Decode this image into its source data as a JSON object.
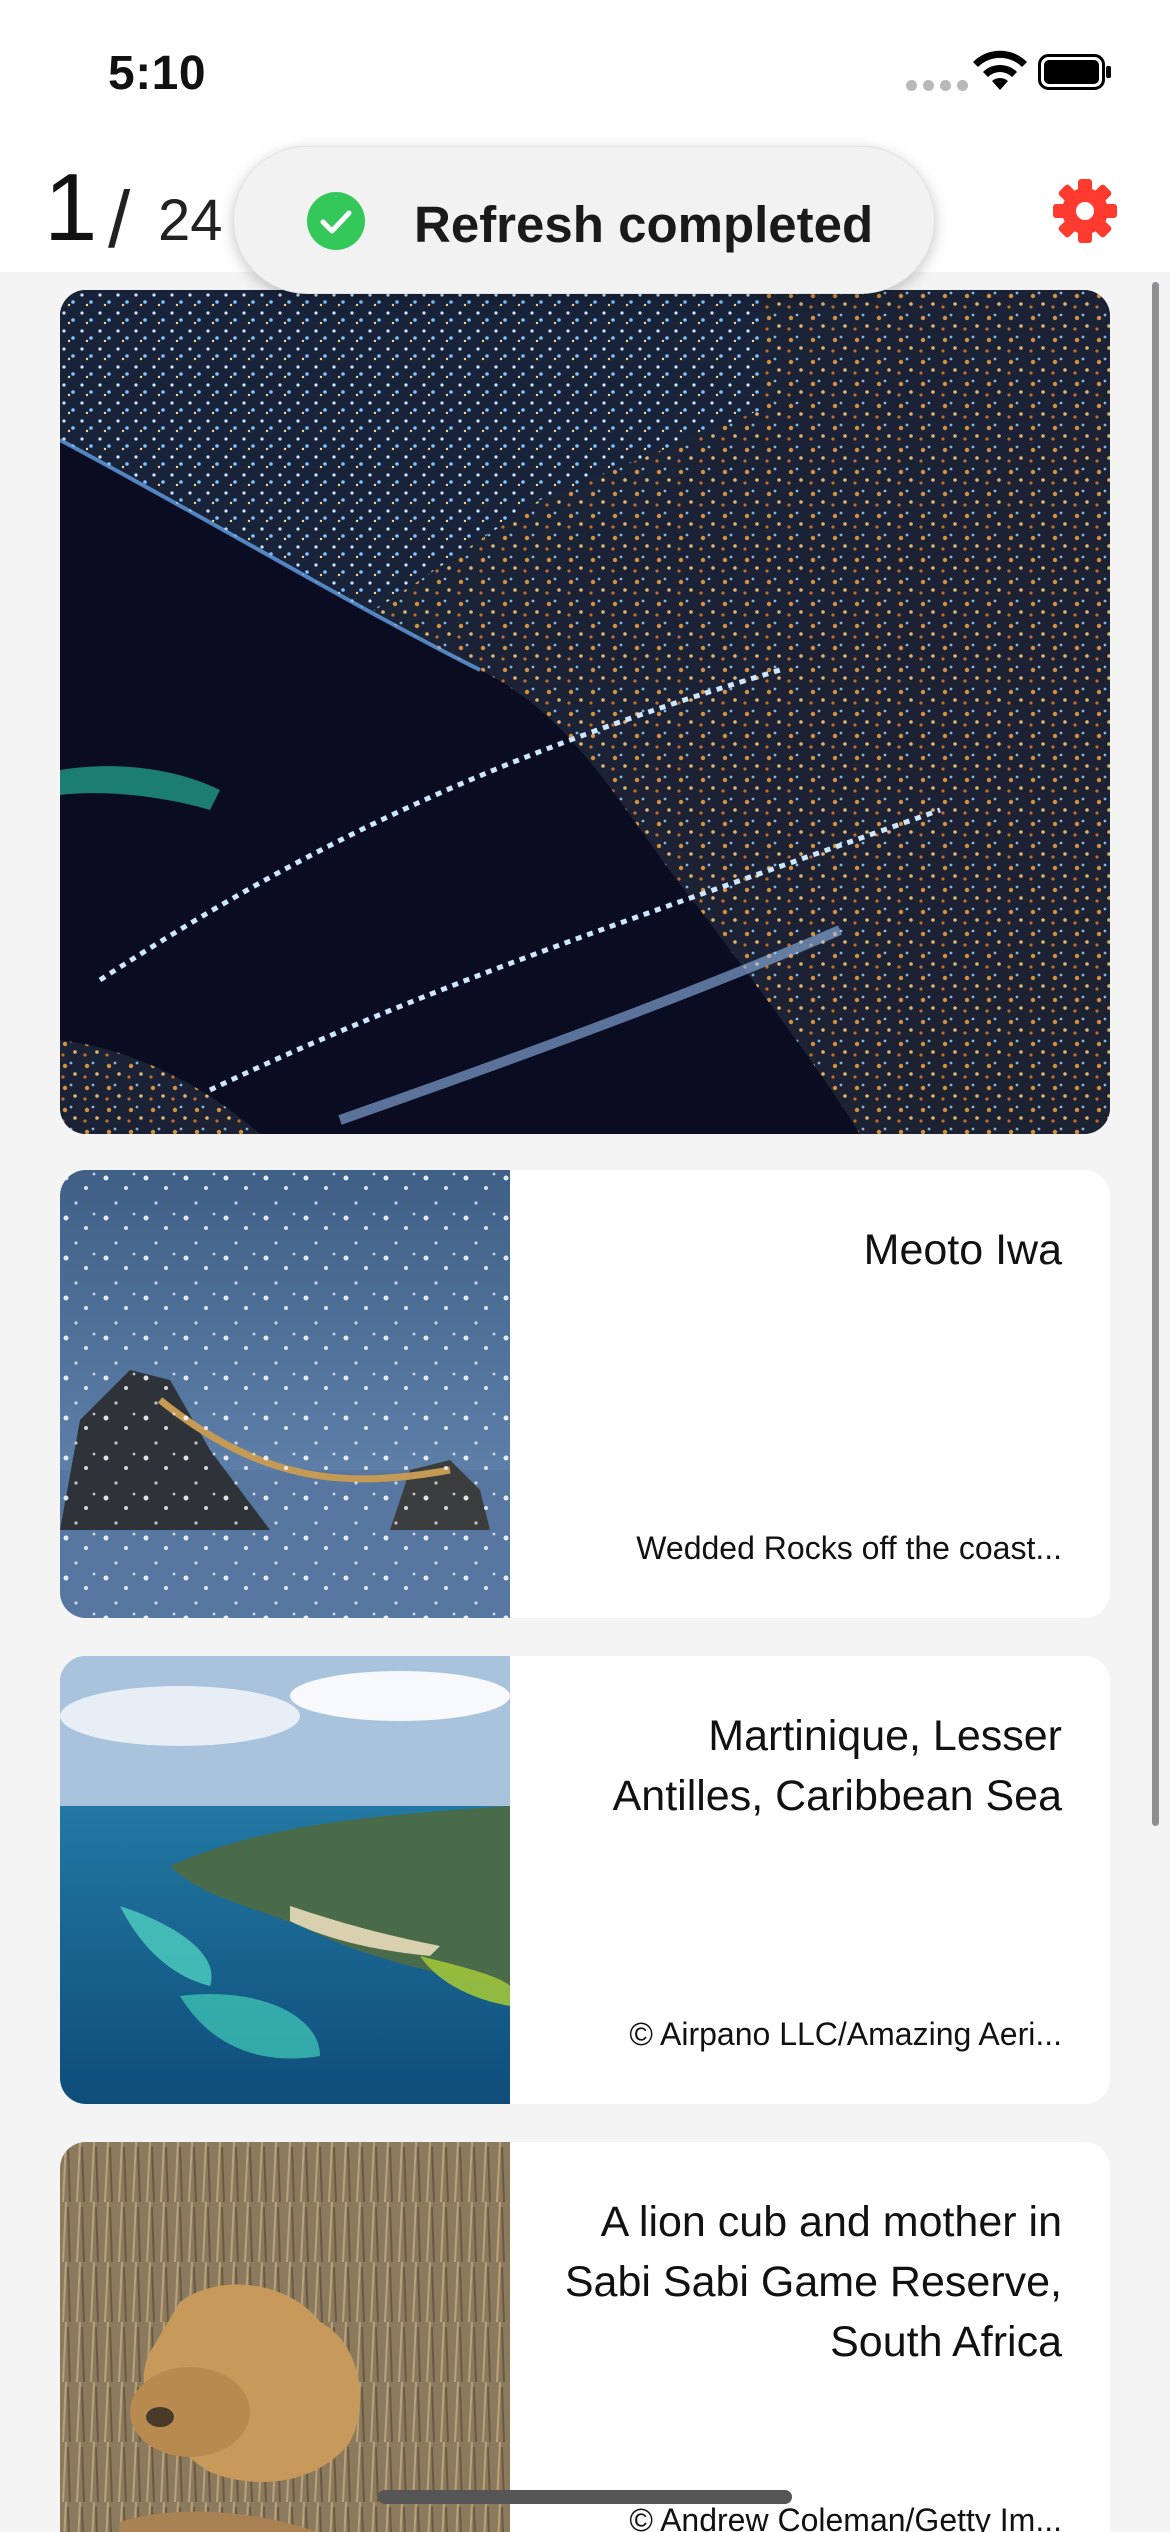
{
  "status_bar": {
    "time": "5:10"
  },
  "header": {
    "current_index": "1",
    "separator": "/",
    "total": "24",
    "settings_icon": "gear-icon",
    "accent_color": "#ff3b30"
  },
  "toast": {
    "icon": "check-circle-icon",
    "message": "Refresh completed",
    "icon_color": "#34c759"
  },
  "feed": {
    "hero": {
      "image": "aerial-night-city-bridges-photo"
    },
    "cards": [
      {
        "title": "Meoto Iwa",
        "subtitle": "Wedded Rocks off the coast...",
        "image": "wedded-rocks-snow-photo"
      },
      {
        "title": "Martinique, Lesser Antilles, Caribbean Sea",
        "subtitle": "© Airpano LLC/Amazing Aeri...",
        "image": "martinique-coast-aerial-photo"
      },
      {
        "title": "A lion cub and mother in Sabi Sabi Game Reserve, South Africa",
        "subtitle": "© Andrew Coleman/Getty Im...",
        "image": "lioness-and-cub-photo"
      }
    ]
  }
}
